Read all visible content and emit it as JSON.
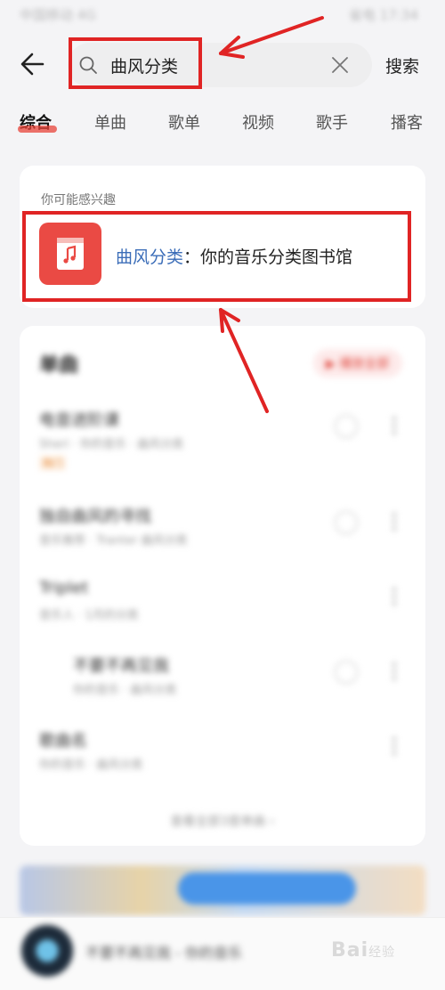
{
  "status": {
    "left": "中国移动 4G",
    "right": "省电 17:34"
  },
  "search": {
    "query": "曲风分类",
    "action": "搜索"
  },
  "tabs": [
    "综合",
    "单曲",
    "歌单",
    "视频",
    "歌手",
    "播客"
  ],
  "interest": {
    "label": "你可能感兴趣",
    "keyword": "曲风分类",
    "separator": "：",
    "title": "你的音乐分类图书馆"
  },
  "songs": {
    "header": "单曲",
    "play_all": "▶ 播放全部",
    "items": [
      {
        "title": "电音进阶课",
        "sub": "Sheri · 你的音乐 · 曲风分类",
        "tag": "热门"
      },
      {
        "title": "独自曲风的寻找",
        "sub": "音乐推荐 · Tranter 曲风分类",
        "tag": ""
      },
      {
        "title": "Triplet",
        "sub": "音乐人 · 1月的分类",
        "tag": ""
      },
      {
        "title": "不要不再见我",
        "sub": "你的音乐 · 曲风分类",
        "tag": ""
      },
      {
        "title": "歌曲名",
        "sub": "你的音乐 · 曲风分类",
        "tag": ""
      }
    ],
    "more": "查看全部3首单曲 ›"
  },
  "player": {
    "title": "不要不再见我 - 你的音乐"
  },
  "watermark": {
    "brand": "Bai",
    "suffix": "经验"
  }
}
